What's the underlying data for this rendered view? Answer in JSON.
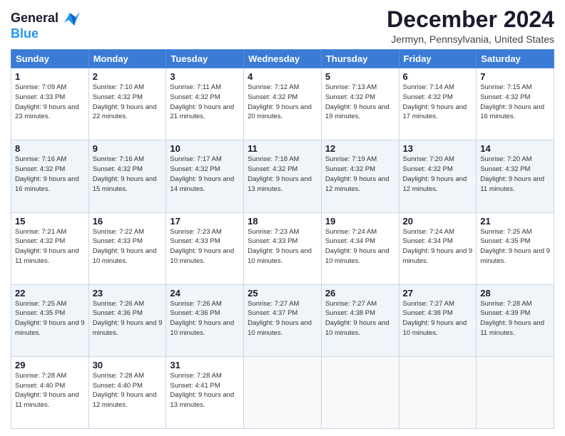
{
  "logo": {
    "line1": "General",
    "line2": "Blue"
  },
  "title": "December 2024",
  "subtitle": "Jermyn, Pennsylvania, United States",
  "headers": [
    "Sunday",
    "Monday",
    "Tuesday",
    "Wednesday",
    "Thursday",
    "Friday",
    "Saturday"
  ],
  "weeks": [
    [
      {
        "day": "1",
        "rise": "Sunrise: 7:09 AM",
        "set": "Sunset: 4:33 PM",
        "daylight": "Daylight: 9 hours and 23 minutes."
      },
      {
        "day": "2",
        "rise": "Sunrise: 7:10 AM",
        "set": "Sunset: 4:32 PM",
        "daylight": "Daylight: 9 hours and 22 minutes."
      },
      {
        "day": "3",
        "rise": "Sunrise: 7:11 AM",
        "set": "Sunset: 4:32 PM",
        "daylight": "Daylight: 9 hours and 21 minutes."
      },
      {
        "day": "4",
        "rise": "Sunrise: 7:12 AM",
        "set": "Sunset: 4:32 PM",
        "daylight": "Daylight: 9 hours and 20 minutes."
      },
      {
        "day": "5",
        "rise": "Sunrise: 7:13 AM",
        "set": "Sunset: 4:32 PM",
        "daylight": "Daylight: 9 hours and 19 minutes."
      },
      {
        "day": "6",
        "rise": "Sunrise: 7:14 AM",
        "set": "Sunset: 4:32 PM",
        "daylight": "Daylight: 9 hours and 17 minutes."
      },
      {
        "day": "7",
        "rise": "Sunrise: 7:15 AM",
        "set": "Sunset: 4:32 PM",
        "daylight": "Daylight: 9 hours and 16 minutes."
      }
    ],
    [
      {
        "day": "8",
        "rise": "Sunrise: 7:16 AM",
        "set": "Sunset: 4:32 PM",
        "daylight": "Daylight: 9 hours and 16 minutes."
      },
      {
        "day": "9",
        "rise": "Sunrise: 7:16 AM",
        "set": "Sunset: 4:32 PM",
        "daylight": "Daylight: 9 hours and 15 minutes."
      },
      {
        "day": "10",
        "rise": "Sunrise: 7:17 AM",
        "set": "Sunset: 4:32 PM",
        "daylight": "Daylight: 9 hours and 14 minutes."
      },
      {
        "day": "11",
        "rise": "Sunrise: 7:18 AM",
        "set": "Sunset: 4:32 PM",
        "daylight": "Daylight: 9 hours and 13 minutes."
      },
      {
        "day": "12",
        "rise": "Sunrise: 7:19 AM",
        "set": "Sunset: 4:32 PM",
        "daylight": "Daylight: 9 hours and 12 minutes."
      },
      {
        "day": "13",
        "rise": "Sunrise: 7:20 AM",
        "set": "Sunset: 4:32 PM",
        "daylight": "Daylight: 9 hours and 12 minutes."
      },
      {
        "day": "14",
        "rise": "Sunrise: 7:20 AM",
        "set": "Sunset: 4:32 PM",
        "daylight": "Daylight: 9 hours and 11 minutes."
      }
    ],
    [
      {
        "day": "15",
        "rise": "Sunrise: 7:21 AM",
        "set": "Sunset: 4:32 PM",
        "daylight": "Daylight: 9 hours and 11 minutes."
      },
      {
        "day": "16",
        "rise": "Sunrise: 7:22 AM",
        "set": "Sunset: 4:33 PM",
        "daylight": "Daylight: 9 hours and 10 minutes."
      },
      {
        "day": "17",
        "rise": "Sunrise: 7:23 AM",
        "set": "Sunset: 4:33 PM",
        "daylight": "Daylight: 9 hours and 10 minutes."
      },
      {
        "day": "18",
        "rise": "Sunrise: 7:23 AM",
        "set": "Sunset: 4:33 PM",
        "daylight": "Daylight: 9 hours and 10 minutes."
      },
      {
        "day": "19",
        "rise": "Sunrise: 7:24 AM",
        "set": "Sunset: 4:34 PM",
        "daylight": "Daylight: 9 hours and 10 minutes."
      },
      {
        "day": "20",
        "rise": "Sunrise: 7:24 AM",
        "set": "Sunset: 4:34 PM",
        "daylight": "Daylight: 9 hours and 9 minutes."
      },
      {
        "day": "21",
        "rise": "Sunrise: 7:25 AM",
        "set": "Sunset: 4:35 PM",
        "daylight": "Daylight: 9 hours and 9 minutes."
      }
    ],
    [
      {
        "day": "22",
        "rise": "Sunrise: 7:25 AM",
        "set": "Sunset: 4:35 PM",
        "daylight": "Daylight: 9 hours and 9 minutes."
      },
      {
        "day": "23",
        "rise": "Sunrise: 7:26 AM",
        "set": "Sunset: 4:36 PM",
        "daylight": "Daylight: 9 hours and 9 minutes."
      },
      {
        "day": "24",
        "rise": "Sunrise: 7:26 AM",
        "set": "Sunset: 4:36 PM",
        "daylight": "Daylight: 9 hours and 10 minutes."
      },
      {
        "day": "25",
        "rise": "Sunrise: 7:27 AM",
        "set": "Sunset: 4:37 PM",
        "daylight": "Daylight: 9 hours and 10 minutes."
      },
      {
        "day": "26",
        "rise": "Sunrise: 7:27 AM",
        "set": "Sunset: 4:38 PM",
        "daylight": "Daylight: 9 hours and 10 minutes."
      },
      {
        "day": "27",
        "rise": "Sunrise: 7:27 AM",
        "set": "Sunset: 4:38 PM",
        "daylight": "Daylight: 9 hours and 10 minutes."
      },
      {
        "day": "28",
        "rise": "Sunrise: 7:28 AM",
        "set": "Sunset: 4:39 PM",
        "daylight": "Daylight: 9 hours and 11 minutes."
      }
    ],
    [
      {
        "day": "29",
        "rise": "Sunrise: 7:28 AM",
        "set": "Sunset: 4:40 PM",
        "daylight": "Daylight: 9 hours and 11 minutes."
      },
      {
        "day": "30",
        "rise": "Sunrise: 7:28 AM",
        "set": "Sunset: 4:40 PM",
        "daylight": "Daylight: 9 hours and 12 minutes."
      },
      {
        "day": "31",
        "rise": "Sunrise: 7:28 AM",
        "set": "Sunset: 4:41 PM",
        "daylight": "Daylight: 9 hours and 13 minutes."
      },
      null,
      null,
      null,
      null
    ]
  ]
}
